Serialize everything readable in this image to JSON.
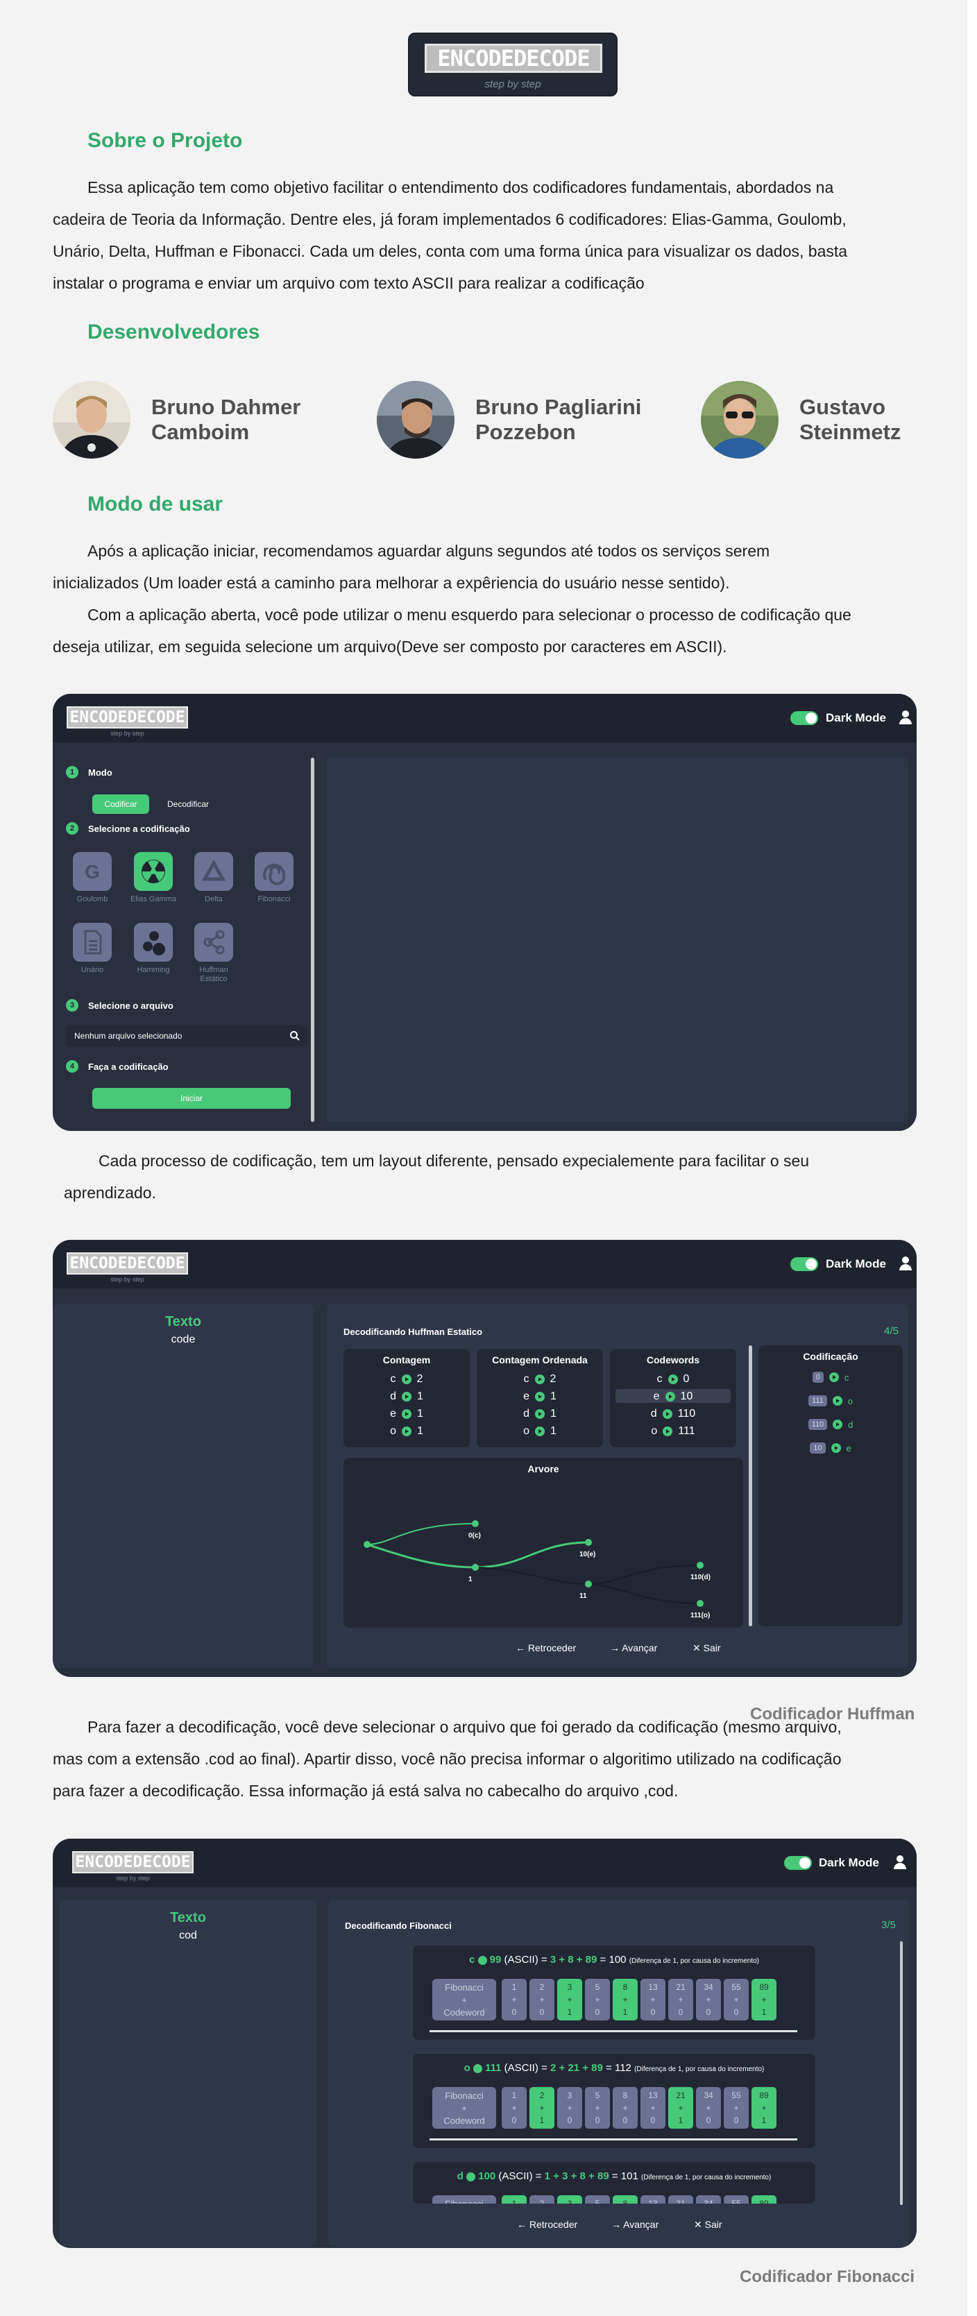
{
  "logo": {
    "text": "ENCODEDECODE",
    "subtitle": "step by step"
  },
  "about": {
    "title": "Sobre o Projeto",
    "lines": [
      "Essa aplicação tem como objetivo facilitar o entendimento dos codificadores fundamentais, abordados na",
      "cadeira de Teoria da Informação. Dentre eles, já foram implementados 6 codificadores: Elias-Gamma, Goulomb,",
      "Unário, Delta, Huffman e Fibonacci. Cada um deles, conta com uma forma única para visualizar os dados, basta",
      "instalar o programa e enviar um arquivo com texto ASCII para realizar a codificação"
    ]
  },
  "developers": {
    "title": "Desenvolvedores",
    "people": [
      {
        "first": "Bruno Dahmer",
        "last": "Camboim"
      },
      {
        "first": "Bruno Pagliarini",
        "last": "Pozzebon"
      },
      {
        "first": "Gustavo",
        "last": "Steinmetz"
      }
    ]
  },
  "usage": {
    "title": "Modo de usar",
    "lines": [
      "Após a aplicação iniciar, recomendamos aguardar alguns segundos até todos os serviços serem",
      "inicializados (Um loader está a caminho para melhorar a expêriencia do usuário nesse sentido).",
      "Com a aplicação aberta, você pode utilizar o menu esquerdo para selecionar o processo de codificação que",
      "deseja utilizar, em seguida selecione um arquivo(Deve ser composto por caracteres em ASCII)."
    ]
  },
  "app_common": {
    "logo": "ENCODEDECODE",
    "logo_sub": "step by step",
    "dark_mode": "Dark Mode",
    "back": "Retroceder",
    "next": "Avançar",
    "exit": "Sair"
  },
  "screen1": {
    "step1": "Modo",
    "encode": "Codificar",
    "decode": "Decodificar",
    "step2": "Selecione a codificação",
    "tiles": [
      {
        "label": "Goulomb",
        "icon": "google-g-icon"
      },
      {
        "label": "Elias Gamma",
        "icon": "radioactive-icon"
      },
      {
        "label": "Delta",
        "icon": "triangle-icon"
      },
      {
        "label": "Fibonacci",
        "icon": "spiral-icon"
      },
      {
        "label": "Unário",
        "icon": "file-icon"
      },
      {
        "label": "Hamming",
        "icon": "dots-icon"
      },
      {
        "label": "Huffman Estático",
        "icon": "share-icon"
      }
    ],
    "step3": "Selecione o arquivo",
    "file_placeholder": "Nenhum arquivo selecionado",
    "step4": "Faça a codificação",
    "start": "Iniciar"
  },
  "para2": [
    "Cada processo de codificação, tem um layout diferente, pensado expecialemente para facilitar o seu",
    "aprendizado."
  ],
  "screen2": {
    "text_title": "Texto",
    "text_value": "code",
    "header": "Decodificando Huffman Estatico",
    "progress": "4/5",
    "contagem": {
      "title": "Contagem",
      "rows": [
        [
          "c",
          "2"
        ],
        [
          "d",
          "1"
        ],
        [
          "e",
          "1"
        ],
        [
          "o",
          "1"
        ]
      ]
    },
    "ordenada": {
      "title": "Contagem Ordenada",
      "rows": [
        [
          "c",
          "2"
        ],
        [
          "e",
          "1"
        ],
        [
          "d",
          "1"
        ],
        [
          "o",
          "1"
        ]
      ]
    },
    "codewords": {
      "title": "Codewords",
      "rows": [
        [
          "c",
          "0"
        ],
        [
          "e",
          "10"
        ],
        [
          "d",
          "110"
        ],
        [
          "o",
          "111"
        ]
      ]
    },
    "codificacao": {
      "title": "Codificação",
      "rows": [
        [
          "0",
          "c"
        ],
        [
          "111",
          "o"
        ],
        [
          "110",
          "d"
        ],
        [
          "10",
          "e"
        ]
      ]
    },
    "tree_title": "Arvore",
    "tree_labels": [
      "0(c)",
      "1",
      "10(e)",
      "11",
      "110(d)",
      "111(o)"
    ]
  },
  "caption_huffman": "Codificador Huffman",
  "para3": [
    "Para fazer a decodificação, você deve selecionar o arquivo que foi gerado da codificação (mesmo arquivo,",
    "mas com a extensão .cod ao final). Apartir disso, você não precisa informar o algoritimo utilizado na codificação",
    "para fazer a decodificação. Essa informação já está salva no cabecalho do arquivo ,cod."
  ],
  "screen3": {
    "text_title": "Texto",
    "text_value": "cod",
    "header": "Decodificando Fibonacci",
    "progress": "3/5",
    "fib_label": [
      "Fibonacci",
      "+",
      "Codeword"
    ],
    "fib_numbers": [
      "1",
      "2",
      "3",
      "5",
      "8",
      "13",
      "21",
      "34",
      "55",
      "89"
    ],
    "blocks": [
      {
        "char": "c",
        "code": "99",
        "sum": "3 + 8 + 89",
        "total": "100",
        "note": "(Diferença de 1, por causa do incremento)",
        "bits": [
          "0",
          "0",
          "1",
          "0",
          "1",
          "0",
          "0",
          "0",
          "0",
          "1"
        ]
      },
      {
        "char": "o",
        "code": "111",
        "sum": "2 + 21 + 89",
        "total": "112",
        "note": "(Diferença de 1, por causa do incremento)",
        "bits": [
          "0",
          "1",
          "0",
          "0",
          "0",
          "0",
          "1",
          "0",
          "0",
          "1"
        ]
      },
      {
        "char": "d",
        "code": "100",
        "sum": "1 + 3 + 8 + 89",
        "total": "101",
        "note": "(Diferença de 1, por causa do incremento)",
        "bits": [
          "1",
          "0",
          "1",
          "0",
          "1",
          "0",
          "0",
          "0",
          "0",
          "1"
        ]
      }
    ],
    "ascii": "(ASCII) ="
  },
  "caption_fibonacci": "Codificador Fibonacci",
  "colors": {
    "accent": "#33a86b",
    "app_green": "#47c97a",
    "app_bg": "#2a2f3f"
  }
}
